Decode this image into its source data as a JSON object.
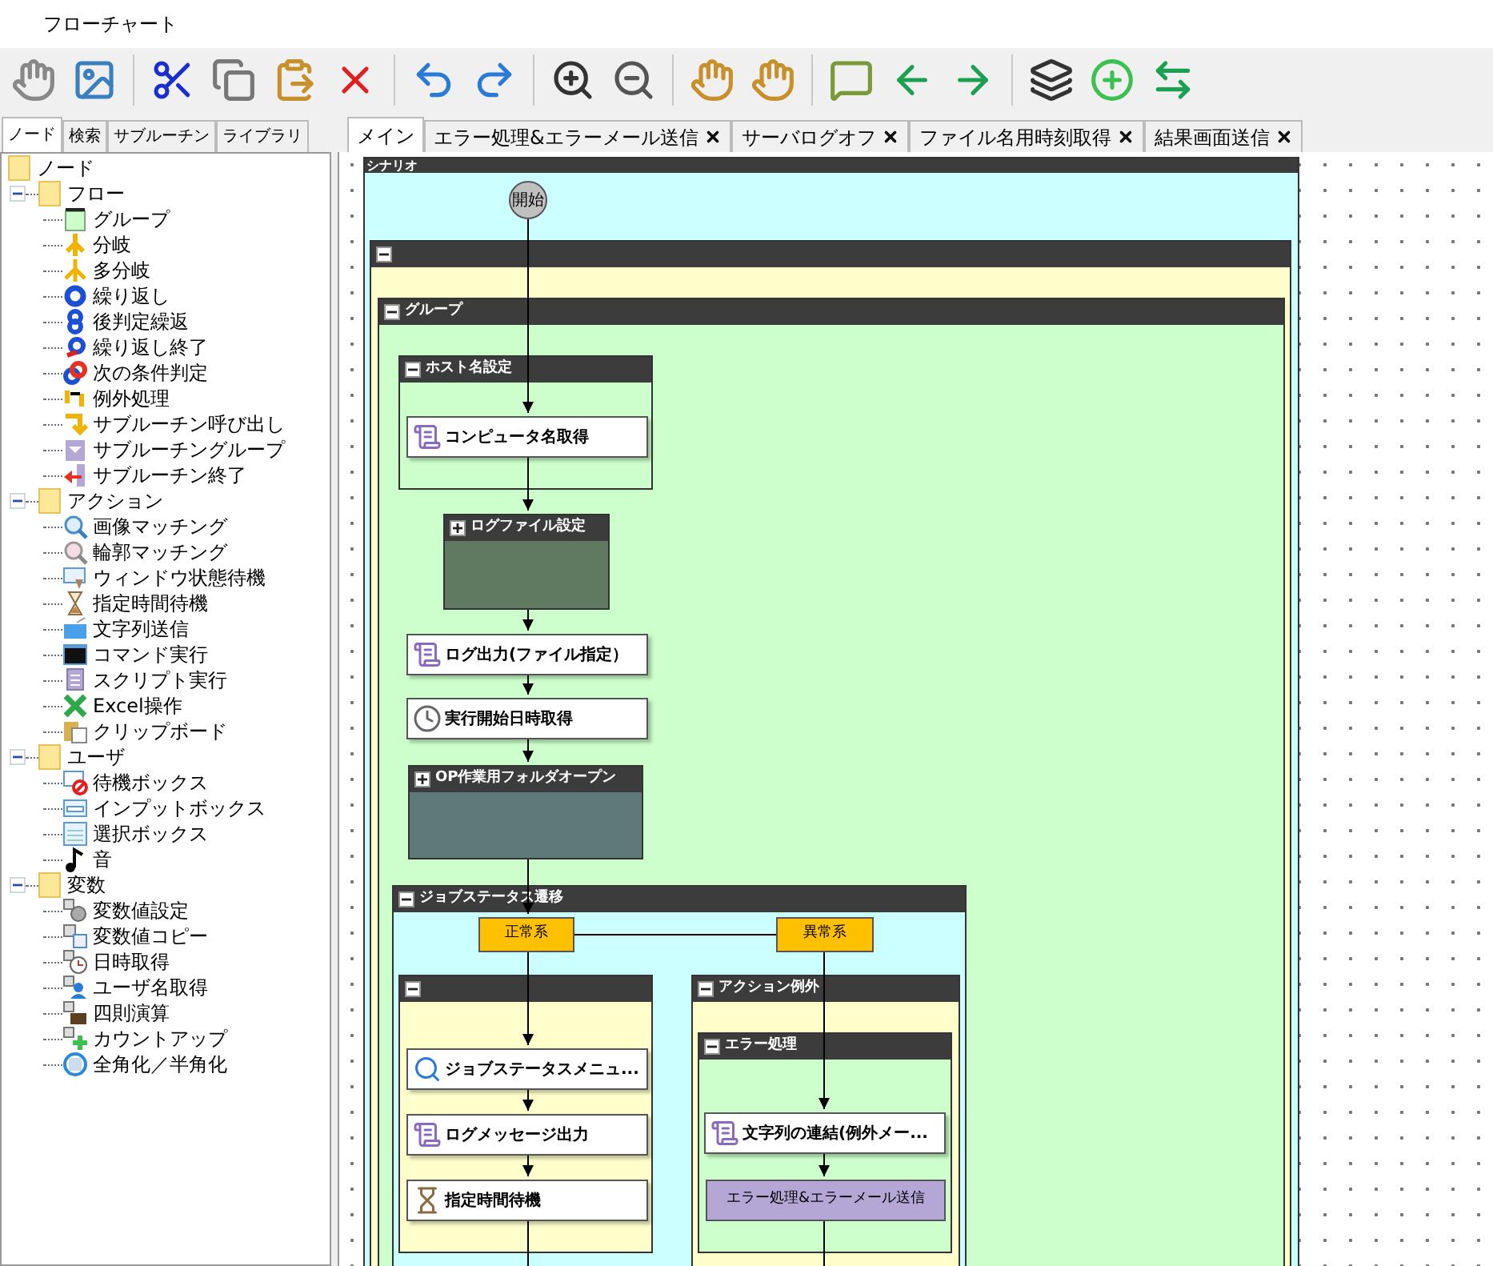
{
  "window": {
    "title": "フローチャート"
  },
  "left_tabs": [
    {
      "label": "ノード",
      "selected": true
    },
    {
      "label": "検索",
      "selected": false
    },
    {
      "label": "サブルーチン",
      "selected": false
    },
    {
      "label": "ライブラリ",
      "selected": false
    }
  ],
  "tree": {
    "label": "ノード",
    "children": [
      {
        "label": "フロー",
        "expanded": true,
        "children": [
          {
            "label": "グループ"
          },
          {
            "label": "分岐"
          },
          {
            "label": "多分岐"
          },
          {
            "label": "繰り返し"
          },
          {
            "label": "後判定繰返"
          },
          {
            "label": "繰り返し終了"
          },
          {
            "label": "次の条件判定"
          },
          {
            "label": "例外処理"
          },
          {
            "label": "サブルーチン呼び出し"
          },
          {
            "label": "サブルーチングループ"
          },
          {
            "label": "サブルーチン終了"
          }
        ]
      },
      {
        "label": "アクション",
        "expanded": true,
        "children": [
          {
            "label": "画像マッチング"
          },
          {
            "label": "輪郭マッチング"
          },
          {
            "label": "ウィンドウ状態待機"
          },
          {
            "label": "指定時間待機"
          },
          {
            "label": "文字列送信"
          },
          {
            "label": "コマンド実行"
          },
          {
            "label": "スクリプト実行"
          },
          {
            "label": "Excel操作"
          },
          {
            "label": "クリップボード"
          }
        ]
      },
      {
        "label": "ユーザ",
        "expanded": true,
        "children": [
          {
            "label": "待機ボックス"
          },
          {
            "label": "インプットボックス"
          },
          {
            "label": "選択ボックス"
          },
          {
            "label": "音"
          }
        ]
      },
      {
        "label": "変数",
        "expanded": true,
        "children": [
          {
            "label": "変数値設定"
          },
          {
            "label": "変数値コピー"
          },
          {
            "label": "日時取得"
          },
          {
            "label": "ユーザ名取得"
          },
          {
            "label": "四則演算"
          },
          {
            "label": "カウントアップ"
          },
          {
            "label": "全角化／半角化"
          }
        ]
      }
    ]
  },
  "editor_tabs": [
    {
      "label": "メイン",
      "selected": true,
      "closable": false
    },
    {
      "label": "エラー処理&エラーメール送信",
      "selected": false,
      "closable": true
    },
    {
      "label": "サーバログオフ",
      "selected": false,
      "closable": true
    },
    {
      "label": "ファイル名用時刻取得",
      "selected": false,
      "closable": true
    },
    {
      "label": "結果画面送信",
      "selected": false,
      "closable": true
    }
  ],
  "flowchart": [
    {
      "kind": "scenario",
      "title": "シナリオ"
    },
    {
      "kind": "start",
      "label": "開始"
    },
    {
      "kind": "block",
      "expanded": true
    },
    {
      "kind": "block",
      "title": "グループ",
      "expanded": true
    },
    {
      "kind": "block",
      "title": "ホスト名設定",
      "expanded": true
    },
    {
      "kind": "step",
      "label": "コンピュータ名取得"
    },
    {
      "kind": "block",
      "title": "ログファイル設定",
      "expanded": false
    },
    {
      "kind": "step",
      "label": "ログ出力(ファイル指定）"
    },
    {
      "kind": "step",
      "label": "実行開始日時取得"
    },
    {
      "kind": "block",
      "title": "OP作業用フォルダオープン",
      "expanded": false
    },
    {
      "kind": "block",
      "title": "ジョブステータス遷移",
      "expanded": true
    },
    {
      "kind": "branch",
      "label": "正常系"
    },
    {
      "kind": "branch",
      "label": "異常系"
    },
    {
      "kind": "block",
      "expanded": true
    },
    {
      "kind": "step",
      "label": "ジョブステータスメニュ..."
    },
    {
      "kind": "step",
      "label": "ログメッセージ出力"
    },
    {
      "kind": "step",
      "label": "指定時間待機"
    },
    {
      "kind": "block",
      "title": "アクション例外",
      "expanded": true
    },
    {
      "kind": "block",
      "title": "エラー処理",
      "expanded": true
    },
    {
      "kind": "step",
      "label": "文字列の連結(例外メー..."
    },
    {
      "kind": "call",
      "label": "エラー処理&エラーメール送信"
    }
  ]
}
